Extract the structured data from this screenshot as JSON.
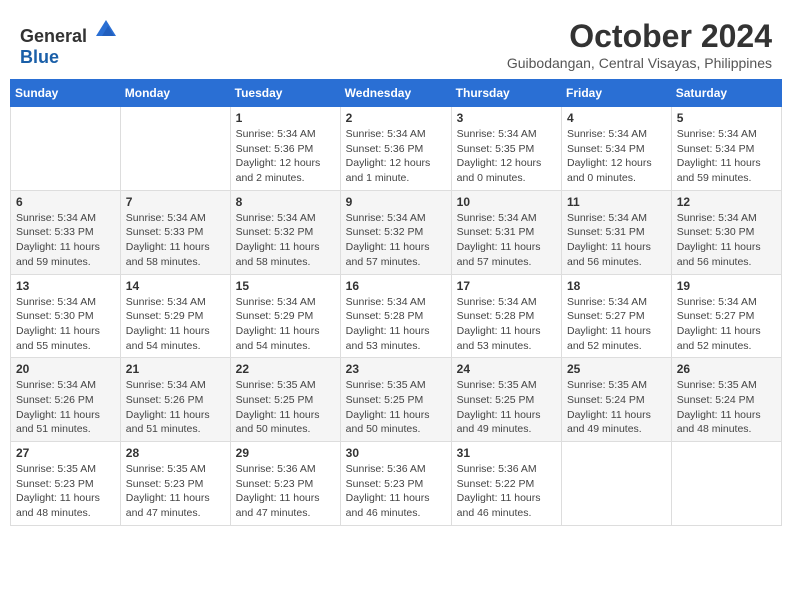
{
  "header": {
    "logo_general": "General",
    "logo_blue": "Blue",
    "month_year": "October 2024",
    "location": "Guibodangan, Central Visayas, Philippines"
  },
  "weekdays": [
    "Sunday",
    "Monday",
    "Tuesday",
    "Wednesday",
    "Thursday",
    "Friday",
    "Saturday"
  ],
  "weeks": [
    [
      {
        "day": "",
        "sunrise": "",
        "sunset": "",
        "daylight": ""
      },
      {
        "day": "",
        "sunrise": "",
        "sunset": "",
        "daylight": ""
      },
      {
        "day": "1",
        "sunrise": "Sunrise: 5:34 AM",
        "sunset": "Sunset: 5:36 PM",
        "daylight": "Daylight: 12 hours and 2 minutes."
      },
      {
        "day": "2",
        "sunrise": "Sunrise: 5:34 AM",
        "sunset": "Sunset: 5:36 PM",
        "daylight": "Daylight: 12 hours and 1 minute."
      },
      {
        "day": "3",
        "sunrise": "Sunrise: 5:34 AM",
        "sunset": "Sunset: 5:35 PM",
        "daylight": "Daylight: 12 hours and 0 minutes."
      },
      {
        "day": "4",
        "sunrise": "Sunrise: 5:34 AM",
        "sunset": "Sunset: 5:34 PM",
        "daylight": "Daylight: 12 hours and 0 minutes."
      },
      {
        "day": "5",
        "sunrise": "Sunrise: 5:34 AM",
        "sunset": "Sunset: 5:34 PM",
        "daylight": "Daylight: 11 hours and 59 minutes."
      }
    ],
    [
      {
        "day": "6",
        "sunrise": "Sunrise: 5:34 AM",
        "sunset": "Sunset: 5:33 PM",
        "daylight": "Daylight: 11 hours and 59 minutes."
      },
      {
        "day": "7",
        "sunrise": "Sunrise: 5:34 AM",
        "sunset": "Sunset: 5:33 PM",
        "daylight": "Daylight: 11 hours and 58 minutes."
      },
      {
        "day": "8",
        "sunrise": "Sunrise: 5:34 AM",
        "sunset": "Sunset: 5:32 PM",
        "daylight": "Daylight: 11 hours and 58 minutes."
      },
      {
        "day": "9",
        "sunrise": "Sunrise: 5:34 AM",
        "sunset": "Sunset: 5:32 PM",
        "daylight": "Daylight: 11 hours and 57 minutes."
      },
      {
        "day": "10",
        "sunrise": "Sunrise: 5:34 AM",
        "sunset": "Sunset: 5:31 PM",
        "daylight": "Daylight: 11 hours and 57 minutes."
      },
      {
        "day": "11",
        "sunrise": "Sunrise: 5:34 AM",
        "sunset": "Sunset: 5:31 PM",
        "daylight": "Daylight: 11 hours and 56 minutes."
      },
      {
        "day": "12",
        "sunrise": "Sunrise: 5:34 AM",
        "sunset": "Sunset: 5:30 PM",
        "daylight": "Daylight: 11 hours and 56 minutes."
      }
    ],
    [
      {
        "day": "13",
        "sunrise": "Sunrise: 5:34 AM",
        "sunset": "Sunset: 5:30 PM",
        "daylight": "Daylight: 11 hours and 55 minutes."
      },
      {
        "day": "14",
        "sunrise": "Sunrise: 5:34 AM",
        "sunset": "Sunset: 5:29 PM",
        "daylight": "Daylight: 11 hours and 54 minutes."
      },
      {
        "day": "15",
        "sunrise": "Sunrise: 5:34 AM",
        "sunset": "Sunset: 5:29 PM",
        "daylight": "Daylight: 11 hours and 54 minutes."
      },
      {
        "day": "16",
        "sunrise": "Sunrise: 5:34 AM",
        "sunset": "Sunset: 5:28 PM",
        "daylight": "Daylight: 11 hours and 53 minutes."
      },
      {
        "day": "17",
        "sunrise": "Sunrise: 5:34 AM",
        "sunset": "Sunset: 5:28 PM",
        "daylight": "Daylight: 11 hours and 53 minutes."
      },
      {
        "day": "18",
        "sunrise": "Sunrise: 5:34 AM",
        "sunset": "Sunset: 5:27 PM",
        "daylight": "Daylight: 11 hours and 52 minutes."
      },
      {
        "day": "19",
        "sunrise": "Sunrise: 5:34 AM",
        "sunset": "Sunset: 5:27 PM",
        "daylight": "Daylight: 11 hours and 52 minutes."
      }
    ],
    [
      {
        "day": "20",
        "sunrise": "Sunrise: 5:34 AM",
        "sunset": "Sunset: 5:26 PM",
        "daylight": "Daylight: 11 hours and 51 minutes."
      },
      {
        "day": "21",
        "sunrise": "Sunrise: 5:34 AM",
        "sunset": "Sunset: 5:26 PM",
        "daylight": "Daylight: 11 hours and 51 minutes."
      },
      {
        "day": "22",
        "sunrise": "Sunrise: 5:35 AM",
        "sunset": "Sunset: 5:25 PM",
        "daylight": "Daylight: 11 hours and 50 minutes."
      },
      {
        "day": "23",
        "sunrise": "Sunrise: 5:35 AM",
        "sunset": "Sunset: 5:25 PM",
        "daylight": "Daylight: 11 hours and 50 minutes."
      },
      {
        "day": "24",
        "sunrise": "Sunrise: 5:35 AM",
        "sunset": "Sunset: 5:25 PM",
        "daylight": "Daylight: 11 hours and 49 minutes."
      },
      {
        "day": "25",
        "sunrise": "Sunrise: 5:35 AM",
        "sunset": "Sunset: 5:24 PM",
        "daylight": "Daylight: 11 hours and 49 minutes."
      },
      {
        "day": "26",
        "sunrise": "Sunrise: 5:35 AM",
        "sunset": "Sunset: 5:24 PM",
        "daylight": "Daylight: 11 hours and 48 minutes."
      }
    ],
    [
      {
        "day": "27",
        "sunrise": "Sunrise: 5:35 AM",
        "sunset": "Sunset: 5:23 PM",
        "daylight": "Daylight: 11 hours and 48 minutes."
      },
      {
        "day": "28",
        "sunrise": "Sunrise: 5:35 AM",
        "sunset": "Sunset: 5:23 PM",
        "daylight": "Daylight: 11 hours and 47 minutes."
      },
      {
        "day": "29",
        "sunrise": "Sunrise: 5:36 AM",
        "sunset": "Sunset: 5:23 PM",
        "daylight": "Daylight: 11 hours and 47 minutes."
      },
      {
        "day": "30",
        "sunrise": "Sunrise: 5:36 AM",
        "sunset": "Sunset: 5:23 PM",
        "daylight": "Daylight: 11 hours and 46 minutes."
      },
      {
        "day": "31",
        "sunrise": "Sunrise: 5:36 AM",
        "sunset": "Sunset: 5:22 PM",
        "daylight": "Daylight: 11 hours and 46 minutes."
      },
      {
        "day": "",
        "sunrise": "",
        "sunset": "",
        "daylight": ""
      },
      {
        "day": "",
        "sunrise": "",
        "sunset": "",
        "daylight": ""
      }
    ]
  ]
}
